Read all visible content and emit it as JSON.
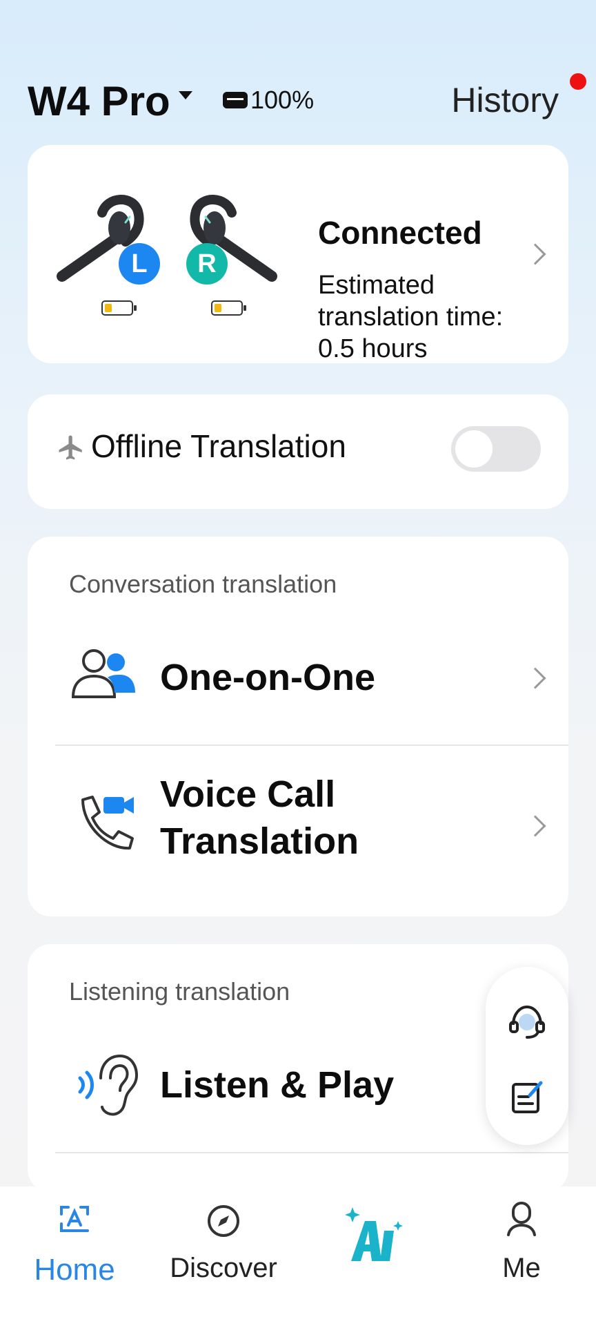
{
  "header": {
    "device_name": "W4 Pro",
    "battery_percent": "100%",
    "history_label": "History",
    "history_has_notification": true
  },
  "device_card": {
    "left_label": "L",
    "right_label": "R",
    "status": "Connected",
    "estimate_line": "Estimated translation time: 0.5 hours",
    "left_color": "#1c87f0",
    "right_color": "#12b9a8",
    "left_battery_level": 0.25,
    "right_battery_level": 0.25
  },
  "offline": {
    "label": "Offline Translation",
    "enabled": false
  },
  "conversation": {
    "section_label": "Conversation translation",
    "items": [
      {
        "title": "One-on-One",
        "icon": "people-icon"
      },
      {
        "title": "Voice Call Translation",
        "icon": "phone-video-icon"
      }
    ]
  },
  "listening": {
    "section_label": "Listening translation",
    "items": [
      {
        "title": "Listen & Play",
        "icon": "ear-icon"
      }
    ]
  },
  "floating": {
    "items": [
      "headset-support-icon",
      "feedback-edit-icon"
    ]
  },
  "nav": {
    "items": [
      {
        "label": "Home",
        "icon": "home-translate-icon",
        "active": true
      },
      {
        "label": "Discover",
        "icon": "compass-icon",
        "active": false
      },
      {
        "label": "",
        "icon": "ai-icon",
        "active": false
      },
      {
        "label": "Me",
        "icon": "profile-icon",
        "active": false
      }
    ]
  },
  "colors": {
    "accent": "#2a86e6",
    "ai_teal": "#1ab3c9",
    "notification": "#ee1111"
  }
}
